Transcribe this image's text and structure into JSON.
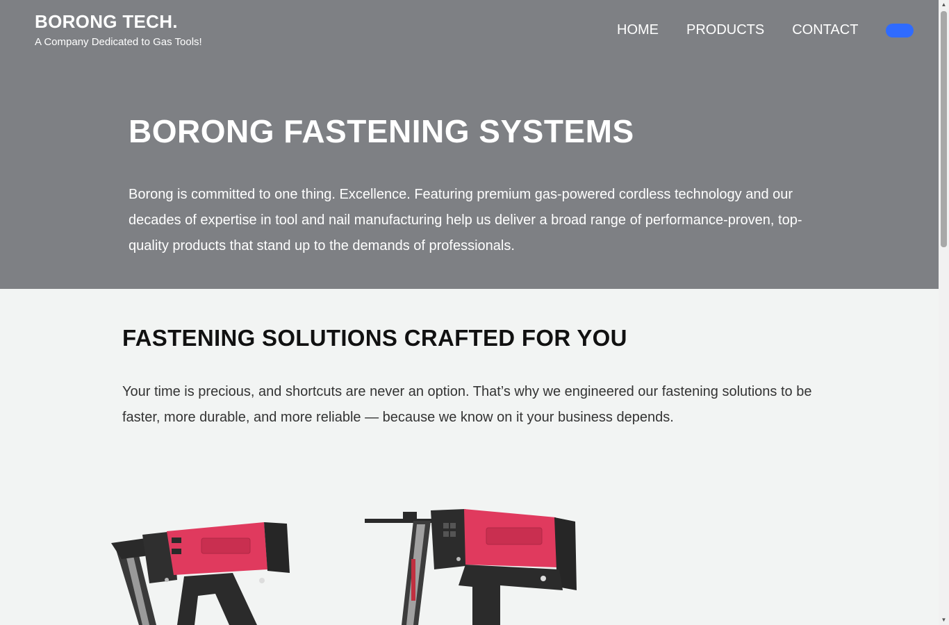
{
  "header": {
    "brand": "BORONG TECH.",
    "tagline": "A Company Dedicated to Gas Tools!",
    "nav": [
      {
        "label": "HOME"
      },
      {
        "label": "PRODUCTS"
      },
      {
        "label": "CONTACT"
      }
    ]
  },
  "hero": {
    "title": "BORONG FASTENING SYSTEMS",
    "text": "Borong is committed to one thing. Excellence. Featuring premium gas-powered cordless technology and our decades of expertise in tool and nail manufacturing help us deliver a broad range of performance-proven, top-quality products that stand up to the demands of professionals."
  },
  "section": {
    "title": "FASTENING SOLUTIONS CRAFTED FOR YOU",
    "text": "Your time is precious, and shortcuts are never an option. That’s why we engineered our fastening solutions to be faster, more durable, and more reliable — because we know on it your business depends."
  },
  "colors": {
    "hero_bg": "#7e8084",
    "page_bg": "#f2f4f3",
    "accent_toggle": "#2f6bff",
    "tool_red": "#e03a5e"
  },
  "icons": {
    "toggle": "menu-toggle-icon",
    "scroll_up": "scroll-up-arrow-icon",
    "scroll_down": "scroll-down-arrow-icon"
  }
}
